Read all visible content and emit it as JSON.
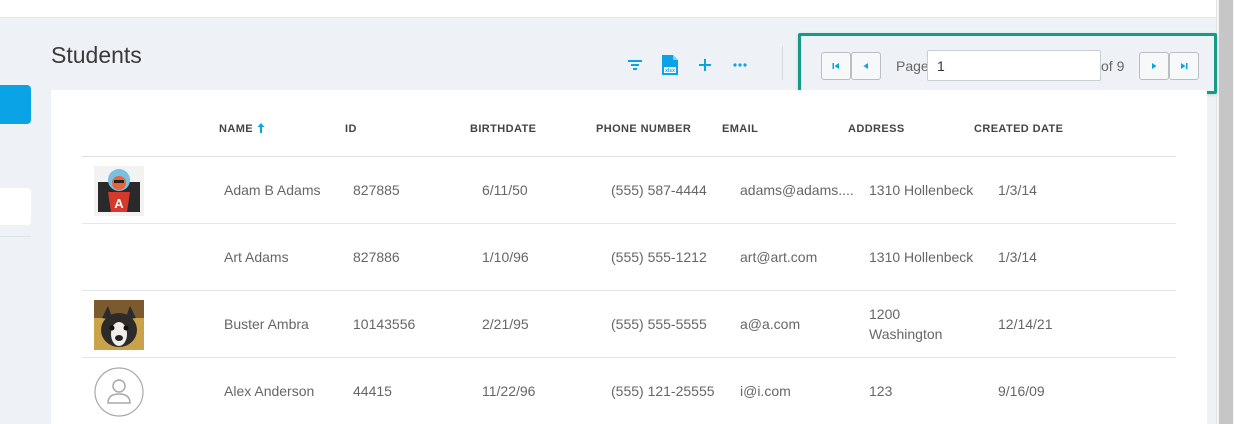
{
  "page": {
    "title": "Students"
  },
  "toolbar": {
    "filter_icon": "filter-icon",
    "export_icon": "xlsx-file-icon",
    "export_badge": "xlsx",
    "add_icon": "plus-icon",
    "more_icon": "more-icon"
  },
  "pager": {
    "page_label": "Page",
    "page_value": "1",
    "of_label": "of 9"
  },
  "table": {
    "columns": [
      "NAME",
      "ID",
      "BIRTHDATE",
      "PHONE NUMBER",
      "EMAIL",
      "ADDRESS",
      "CREATED DATE"
    ],
    "sorted_column": "NAME",
    "sort_direction": "ascending",
    "rows": [
      {
        "avatar": "cartoon-a",
        "name": "Adam B Adams",
        "id": "827885",
        "birthdate": "6/11/50",
        "phone": "(555) 587-4444",
        "email": "adams@adams....",
        "address": "1310 Hollenbeck",
        "address2": "",
        "created": "1/3/14"
      },
      {
        "avatar": "none",
        "name": "Art Adams",
        "id": "827886",
        "birthdate": "1/10/96",
        "phone": "(555) 555-1212",
        "email": "art@art.com",
        "address": "1310 Hollenbeck",
        "address2": "",
        "created": "1/3/14"
      },
      {
        "avatar": "dog-photo",
        "name": "Buster Ambra",
        "id": "10143556",
        "birthdate": "2/21/95",
        "phone": "(555) 555-5555",
        "email": "a@a.com",
        "address": "1200",
        "address2": "Washington",
        "created": "12/14/21"
      },
      {
        "avatar": "placeholder",
        "name": "Alex Anderson",
        "id": "44415",
        "birthdate": "11/22/96",
        "phone": "(555) 121-25555",
        "email": "i@i.com",
        "address": "123",
        "address2": "",
        "created": "9/16/09"
      }
    ]
  },
  "colors": {
    "accent": "#0aa4e6",
    "highlight": "#149b86"
  }
}
